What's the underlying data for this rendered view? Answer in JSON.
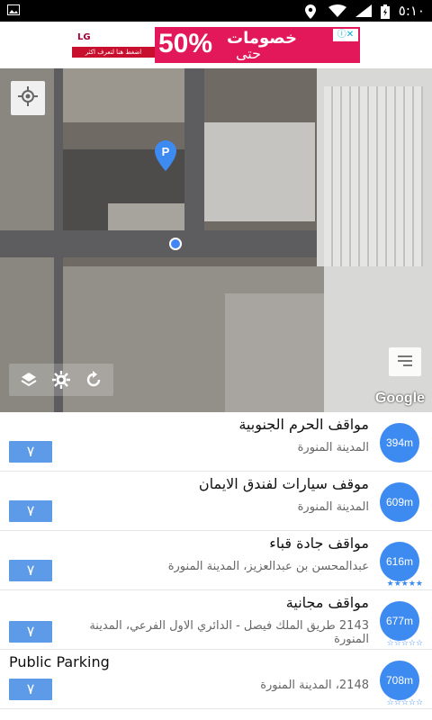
{
  "status_bar": {
    "time": "٥:١٠",
    "icons": [
      "image-icon",
      "wifi-icon",
      "signal-icon",
      "battery-icon",
      "location-icon"
    ]
  },
  "ad": {
    "brand": "LG",
    "strip_text": "اضغط هنا لتعرف اكثر",
    "percent": "50%",
    "headline": "خصومات",
    "headline2": "حتى"
  },
  "map": {
    "attribution": "Google"
  },
  "list": {
    "items": [
      {
        "title": "مواقف الحرم الجنوبية",
        "address": "المدينة المنورة",
        "distance": "394m",
        "stars": "",
        "nav": "٧"
      },
      {
        "title": "موقف سيارات لفندق الايمان",
        "address": "المدينة المنورة",
        "distance": "609m",
        "stars": "",
        "nav": "٧"
      },
      {
        "title": "مواقف جادة قباء",
        "address": "عبدالمحسن بن عبدالعزيز، المدينة المنورة",
        "distance": "616m",
        "stars": "★★★★★",
        "nav": "٧"
      },
      {
        "title": "مواقف مجانية",
        "address": "2143 طريق الملك فيصل - الدائري الاول الفرعي، المدينة المنورة",
        "distance": "677m",
        "stars": "☆☆☆☆☆",
        "nav": "٧"
      },
      {
        "title": "Public Parking",
        "address": "2148، المدينة المنورة",
        "distance": "708m",
        "stars": "☆☆☆☆☆",
        "nav": "٧"
      }
    ]
  },
  "colors": {
    "accent": "#3d8af0",
    "nav_button": "#5d9be8",
    "ad_bg": "#e2185b"
  }
}
